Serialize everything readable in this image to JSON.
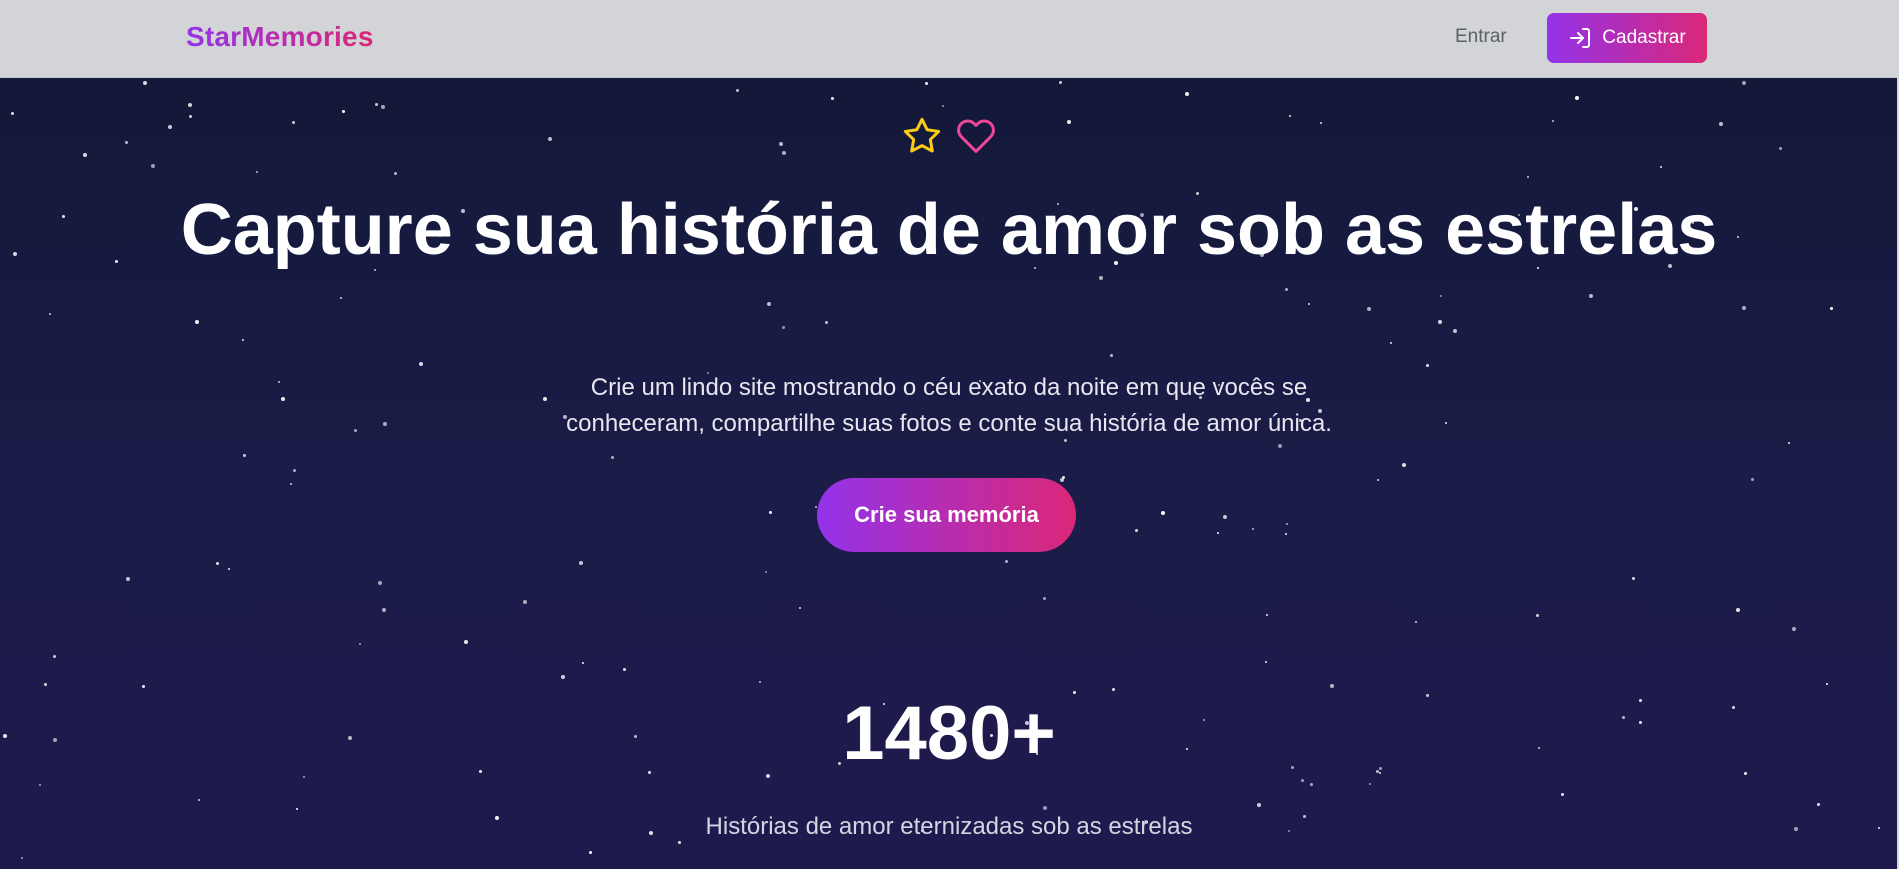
{
  "nav": {
    "logo": "StarMemories",
    "login_label": "Entrar",
    "signup_label": "Cadastrar",
    "signup_icon": "log-in-icon"
  },
  "hero": {
    "icons": [
      "star-icon",
      "heart-icon"
    ],
    "headline": "Capture sua história de amor sob as estrelas",
    "subtitle": "Crie um lindo site mostrando o céu exato da noite em que vocês se conheceram, compartilhe suas fotos e conte sua história de amor única.",
    "cta_label": "Crie sua memória"
  },
  "stats": {
    "count": "1480+",
    "label": "Histórias de amor eternizadas sob as estrelas"
  },
  "colors": {
    "accent_start": "#9333ea",
    "accent_end": "#db2777",
    "star_icon": "#facc15",
    "heart_icon": "#ec4899",
    "background": "#151a36",
    "navbar": "#d3d4d7"
  }
}
